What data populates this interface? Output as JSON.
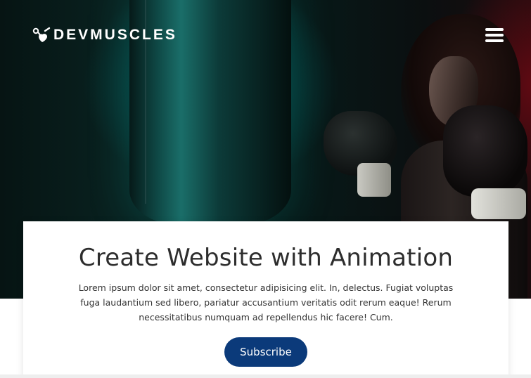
{
  "navbar": {
    "logo_text": "DEVMUSCLES",
    "logo_icon": "stethoscope-heart-icon",
    "menu_icon": "hamburger-menu-icon"
  },
  "hero": {
    "image_subject": "boxer-with-punching-bag"
  },
  "card": {
    "title": "Create Website with Animation",
    "text": "Lorem ipsum dolor sit amet, consectetur adipisicing elit. In, delectus. Fugiat voluptas fuga laudantium sed libero, pariatur accusantium veritatis odit rerum eaque! Rerum necessitatibus numquam ad repellendus hic facere! Cum.",
    "button_label": "Subscribe"
  },
  "colors": {
    "button_bg": "#0b3a7a",
    "title_text": "#2d2d2d",
    "card_bg": "#ffffff",
    "logo_text": "#ffffff"
  }
}
